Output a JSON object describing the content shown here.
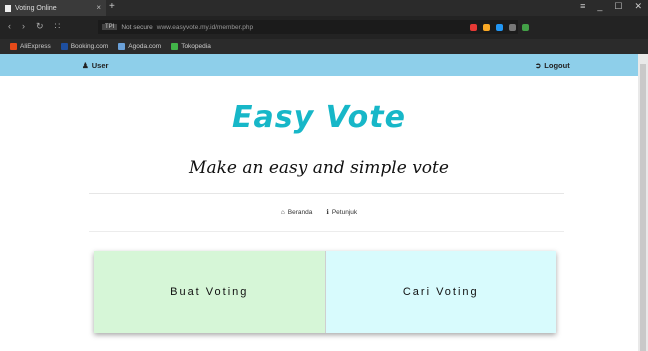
{
  "browser": {
    "tab_title": "Voting Online",
    "tab_close": "×",
    "new_tab": "+",
    "window_controls": [
      "≡",
      "_",
      "☐",
      "✕"
    ],
    "nav_icons": [
      "back-icon",
      "forward-icon",
      "reload-icon",
      "grid-icon"
    ],
    "url_badge": "TPI",
    "security": "Not secure",
    "url": "www.easyvote.my.id/member.php",
    "bookmarks": [
      {
        "label": "AliExpress",
        "color": "#e64a19"
      },
      {
        "label": "Booking.com",
        "color": "#1e4fa0"
      },
      {
        "label": "Agoda.com",
        "color": "#6aa0d8"
      },
      {
        "label": "Tokopedia",
        "color": "#42b549"
      }
    ],
    "extension_colors": [
      "#e53935",
      "#f9a825",
      "#2196f3",
      "#777777",
      "#43a047"
    ]
  },
  "topnav": {
    "user_icon": "user-icon",
    "user_label": "User",
    "logout_icon": "logout-icon",
    "logout_label": "Logout"
  },
  "brand": {
    "title": "Easy Vote",
    "tagline": "Make an easy and simple vote"
  },
  "subnav": {
    "home_label": "Beranda",
    "help_label": "Petunjuk"
  },
  "cards": {
    "buat_label": "Buat Voting",
    "cari_label": "Cari Voting"
  }
}
